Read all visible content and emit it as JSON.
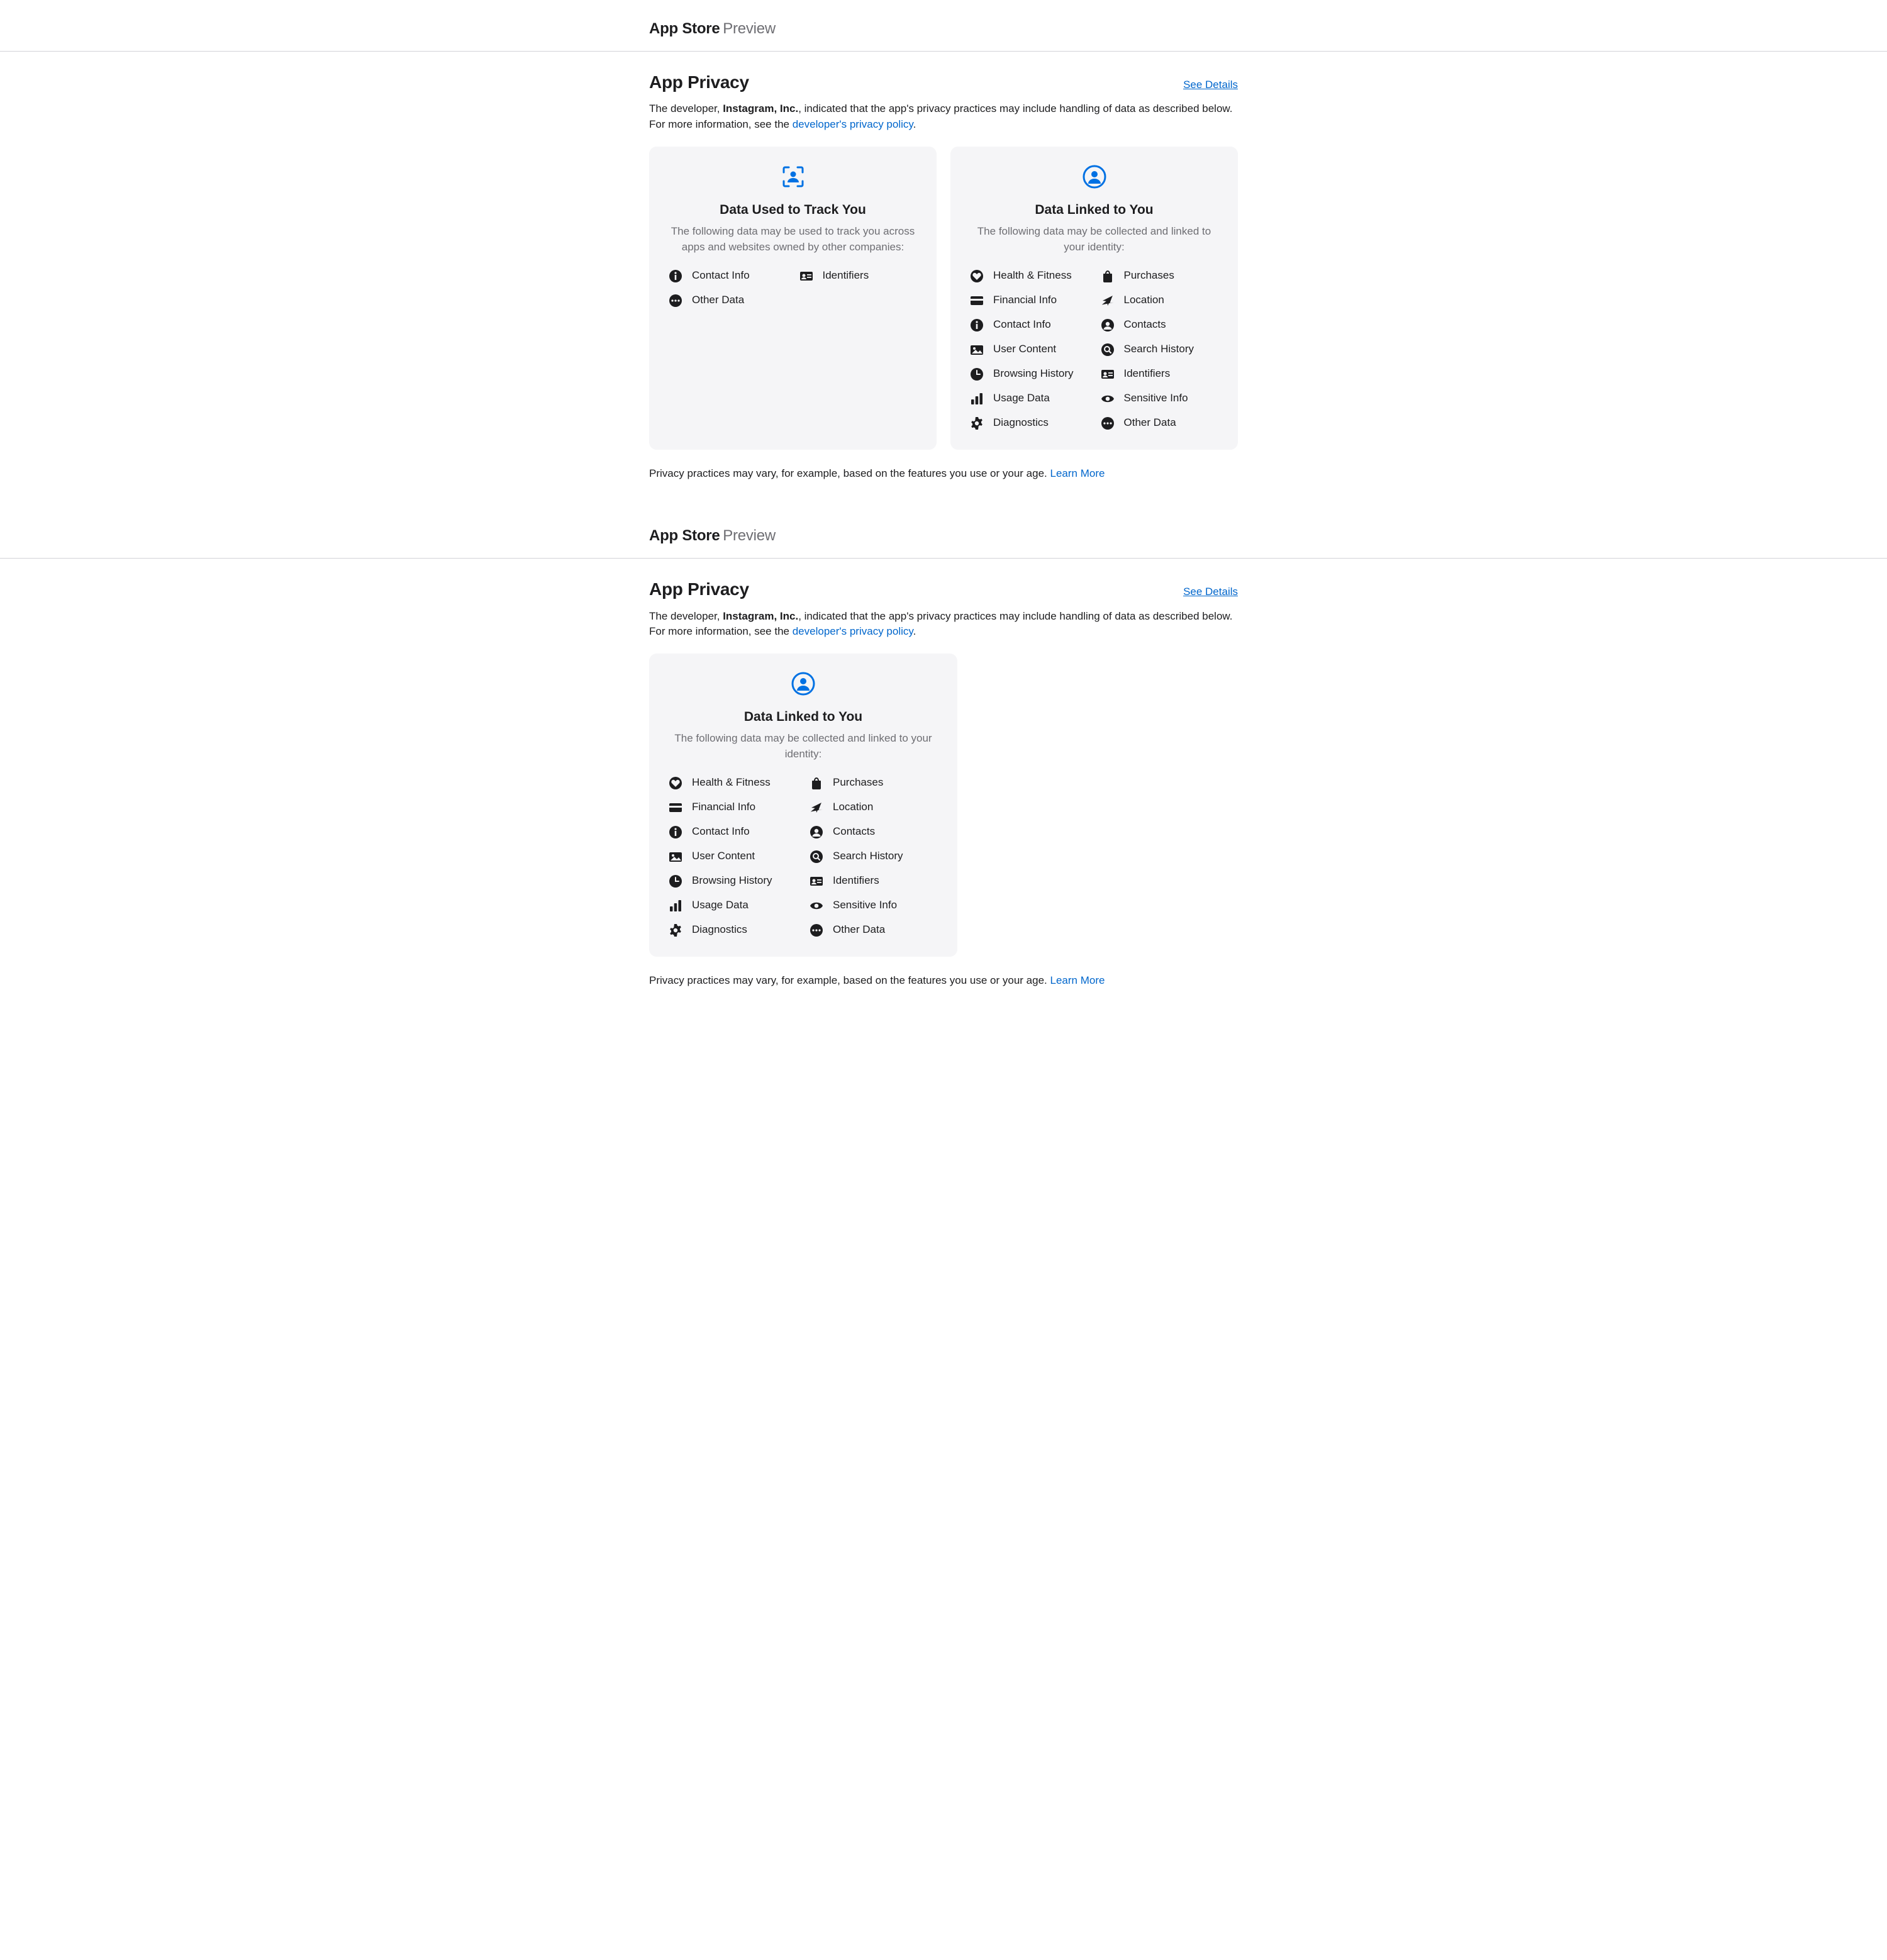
{
  "header": {
    "title": "App Store",
    "suffix": "Preview"
  },
  "section": {
    "title": "App Privacy",
    "details_link": "See Details",
    "intro_before": "The developer, ",
    "developer": "Instagram, Inc.",
    "intro_after": ", indicated that the app's privacy practices may include handling of data as described below. For more information, see the ",
    "policy_link": "developer's privacy policy",
    "intro_period": "."
  },
  "card_track": {
    "title": "Data Used to Track You",
    "subtitle": "The following data may be used to track you across apps and websites owned by other companies:",
    "items": [
      {
        "icon": "info",
        "label": "Contact Info"
      },
      {
        "icon": "idcard",
        "label": "Identifiers"
      },
      {
        "icon": "more",
        "label": "Other Data"
      }
    ]
  },
  "card_linked": {
    "title": "Data Linked to You",
    "subtitle": "The following data may be collected and linked to your identity:",
    "items": [
      {
        "icon": "heart",
        "label": "Health & Fitness"
      },
      {
        "icon": "bag",
        "label": "Purchases"
      },
      {
        "icon": "card",
        "label": "Financial Info"
      },
      {
        "icon": "location",
        "label": "Location"
      },
      {
        "icon": "info",
        "label": "Contact Info"
      },
      {
        "icon": "contact",
        "label": "Contacts"
      },
      {
        "icon": "media",
        "label": "User Content"
      },
      {
        "icon": "search",
        "label": "Search History"
      },
      {
        "icon": "clock",
        "label": "Browsing History"
      },
      {
        "icon": "idcard",
        "label": "Identifiers"
      },
      {
        "icon": "bars",
        "label": "Usage Data"
      },
      {
        "icon": "eye",
        "label": "Sensitive Info"
      },
      {
        "icon": "gear",
        "label": "Diagnostics"
      },
      {
        "icon": "more",
        "label": "Other Data"
      }
    ]
  },
  "footnote": {
    "text": "Privacy practices may vary, for example, based on the features you use or your age. ",
    "link": "Learn More"
  }
}
